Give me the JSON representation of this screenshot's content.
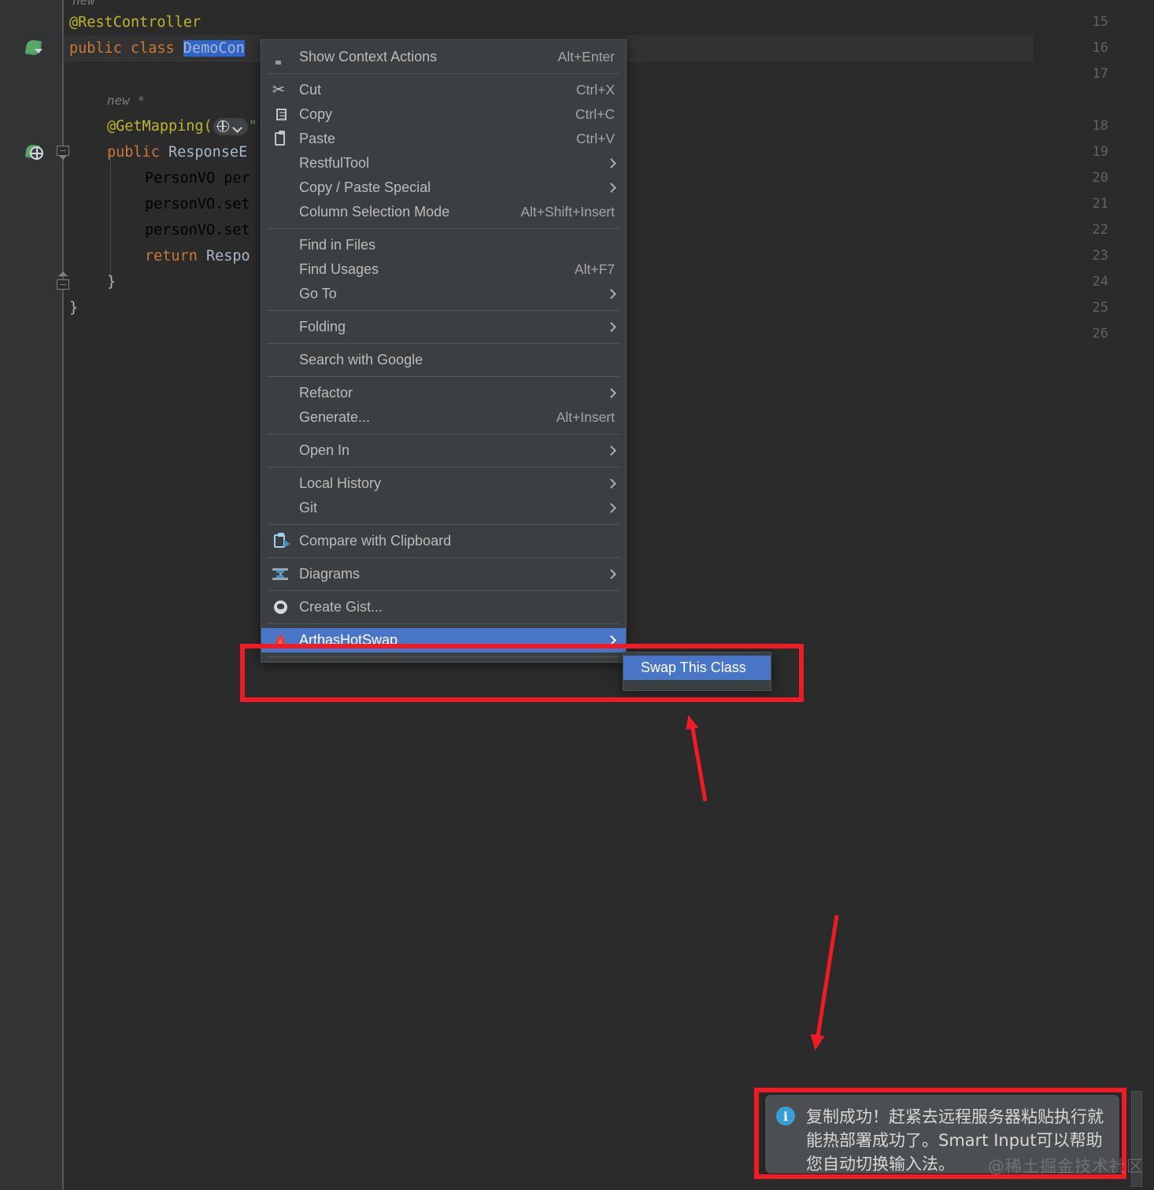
{
  "editor": {
    "line_numbers": [
      "15",
      "16",
      "17",
      "18",
      "19",
      "20",
      "21",
      "22",
      "23",
      "24",
      "25",
      "26"
    ],
    "hint_above": "new",
    "lines": {
      "l15": "@RestController",
      "l16_kw": "public class ",
      "l16_sel": "DemoCon",
      "l17_hint": "new *",
      "l18_ann": "@GetMapping(",
      "l18_tail": "\"",
      "l19_kw": "public ",
      "l19_type": "ResponseE",
      "l20": "PersonVO per",
      "l21": "personVO.set",
      "l22": "personVO.set",
      "l23_kw": "return ",
      "l23_txt": "Respo",
      "l24": "}",
      "l25": "}"
    },
    "gutter_icons": [
      {
        "name": "spring-bean-icon",
        "line": "16"
      },
      {
        "name": "spring-endpoint-icon",
        "line": "19"
      }
    ]
  },
  "context_menu": {
    "items": [
      {
        "label": "Show Context Actions",
        "accel": "Alt+Enter",
        "icon": "lightbulb-icon",
        "submenu": false,
        "sep_after": true
      },
      {
        "label": "Cut",
        "accel": "Ctrl+X",
        "icon": "scissors-icon",
        "submenu": false,
        "mnemonic_last": true
      },
      {
        "label": "Copy",
        "accel": "Ctrl+C",
        "icon": "copy-icon",
        "submenu": false,
        "mnemonic_first": true
      },
      {
        "label": "Paste",
        "accel": "Ctrl+V",
        "icon": "clipboard-icon",
        "submenu": false,
        "mnemonic_first": true
      },
      {
        "label": "RestfulTool",
        "accel": "",
        "icon": "",
        "submenu": true
      },
      {
        "label": "Copy / Paste Special",
        "accel": "",
        "icon": "",
        "submenu": true
      },
      {
        "label": "Column Selection Mode",
        "accel": "Alt+Shift+Insert",
        "icon": "",
        "submenu": false,
        "sep_after": true
      },
      {
        "label": "Find in Files",
        "accel": "",
        "icon": "",
        "submenu": false
      },
      {
        "label": "Find Usages",
        "accel": "Alt+F7",
        "icon": "",
        "submenu": false
      },
      {
        "label": "Go To",
        "accel": "",
        "icon": "",
        "submenu": true,
        "sep_after": true
      },
      {
        "label": "Folding",
        "accel": "",
        "icon": "",
        "submenu": true,
        "sep_after": true
      },
      {
        "label": "Search with Google",
        "accel": "",
        "icon": "",
        "submenu": false,
        "sep_after": true
      },
      {
        "label": "Refactor",
        "accel": "",
        "icon": "",
        "submenu": true
      },
      {
        "label": "Generate...",
        "accel": "Alt+Insert",
        "icon": "",
        "submenu": false,
        "sep_after": true
      },
      {
        "label": "Open In",
        "accel": "",
        "icon": "",
        "submenu": true,
        "sep_after": true
      },
      {
        "label": "Local History",
        "accel": "",
        "icon": "",
        "submenu": true
      },
      {
        "label": "Git",
        "accel": "",
        "icon": "",
        "submenu": true,
        "sep_after": true
      },
      {
        "label": "Compare with Clipboard",
        "accel": "",
        "icon": "compare-clipboard-icon",
        "submenu": false,
        "sep_after": true
      },
      {
        "label": "Diagrams",
        "accel": "",
        "icon": "diagrams-icon",
        "submenu": true,
        "sep_after": true
      },
      {
        "label": "Create Gist...",
        "accel": "",
        "icon": "github-icon",
        "submenu": false,
        "sep_after": true
      },
      {
        "label": "ArthasHotSwap",
        "accel": "",
        "icon": "flame-icon",
        "submenu": true,
        "highlighted": true
      }
    ]
  },
  "submenu": {
    "items": [
      {
        "label": "Swap This Class",
        "highlighted": true
      }
    ]
  },
  "notification": {
    "icon": "info-icon",
    "message": "复制成功！赶紧去远程服务器粘贴执行就能热部署成功了。Smart Input可以帮助您自动切换输入法。"
  },
  "watermark": "@稀土掘金技术社区",
  "annotations": {
    "accent_red": "#ee1c25",
    "highlight_blue": "#4a76c8",
    "arrows": [
      {
        "name": "arrow-to-swap-this-class",
        "direction": "up"
      },
      {
        "name": "arrow-to-notification",
        "direction": "down"
      }
    ]
  }
}
